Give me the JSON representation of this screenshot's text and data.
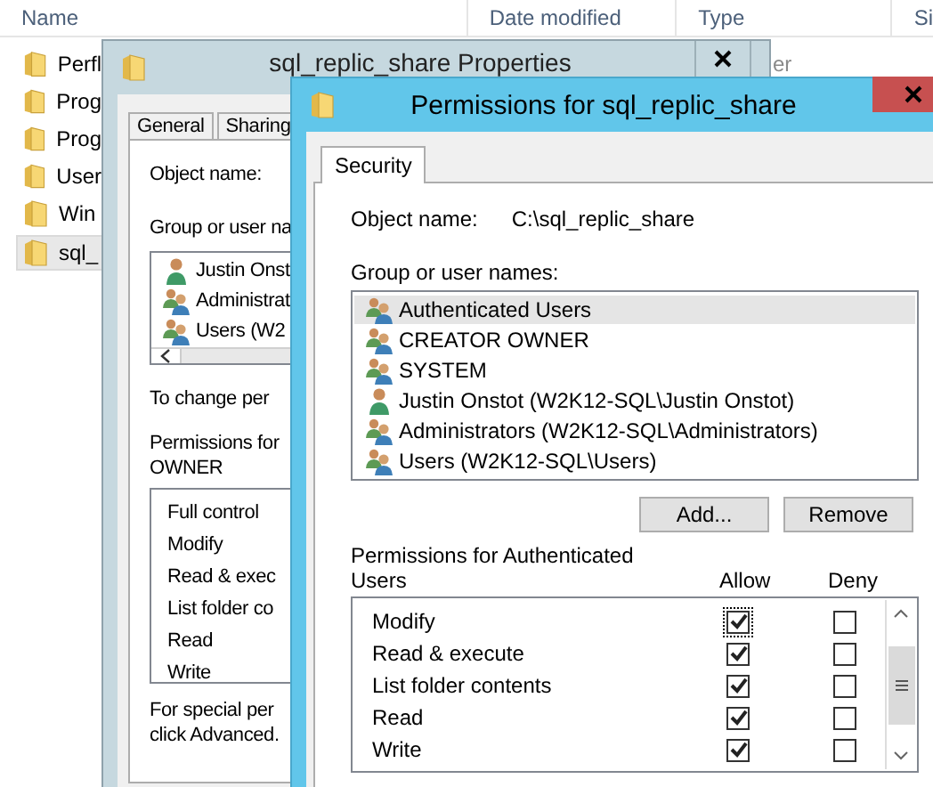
{
  "explorer": {
    "columns": [
      "Name",
      "Date modified",
      "Type",
      "Si"
    ],
    "rows": [
      {
        "name": "Perfl",
        "type": "er",
        "selected": false
      },
      {
        "name": "Prog",
        "selected": false
      },
      {
        "name": "Prog",
        "selected": false
      },
      {
        "name": "User",
        "selected": false
      },
      {
        "name": "Win",
        "selected": false
      },
      {
        "name": "sql_",
        "selected": true
      }
    ]
  },
  "properties_window": {
    "title": "sql_replic_share Properties",
    "tabs": [
      {
        "label": "General",
        "selected": false
      },
      {
        "label": "Sharing",
        "selected": false
      }
    ],
    "object_name_label": "Object name:",
    "group_label": "Group or user na",
    "users": [
      {
        "name": "Justin Onst",
        "kind": "user"
      },
      {
        "name": "Administrat",
        "kind": "group"
      },
      {
        "name": "Users (W2",
        "kind": "group"
      }
    ],
    "change_text": "To change per",
    "permissions_label": [
      "Permissions for",
      "OWNER"
    ],
    "permissions": [
      "Full control",
      "Modify",
      "Read & exec",
      "List folder co",
      "Read",
      "Write"
    ],
    "special_text": [
      "For special per",
      "click Advanced."
    ]
  },
  "permissions_window": {
    "title": "Permissions for sql_replic_share",
    "tabs": [
      {
        "label": "Security",
        "selected": true
      }
    ],
    "object_name_label": "Object name:",
    "object_name": "C:\\sql_replic_share",
    "group_label": "Group or user names:",
    "users": [
      {
        "name": "Authenticated Users",
        "kind": "group",
        "selected": true
      },
      {
        "name": "CREATOR OWNER",
        "kind": "group",
        "selected": false
      },
      {
        "name": "SYSTEM",
        "kind": "group",
        "selected": false
      },
      {
        "name": "Justin Onstot (W2K12-SQL\\Justin Onstot)",
        "kind": "user",
        "selected": false
      },
      {
        "name": "Administrators (W2K12-SQL\\Administrators)",
        "kind": "group",
        "selected": false
      },
      {
        "name": "Users (W2K12-SQL\\Users)",
        "kind": "group",
        "selected": false
      }
    ],
    "buttons": [
      "Add...",
      "Remove"
    ],
    "permissions_label": "Permissions for Authenticated Users",
    "allow_header": "Allow",
    "deny_header": "Deny",
    "permissions": [
      {
        "name": "Modify",
        "allow": true,
        "deny": false,
        "focused": true
      },
      {
        "name": "Read & execute",
        "allow": true,
        "deny": false,
        "focused": false
      },
      {
        "name": "List folder contents",
        "allow": true,
        "deny": false,
        "focused": false
      },
      {
        "name": "Read",
        "allow": true,
        "deny": false,
        "focused": false
      },
      {
        "name": "Write",
        "allow": true,
        "deny": false,
        "focused": false
      }
    ]
  }
}
